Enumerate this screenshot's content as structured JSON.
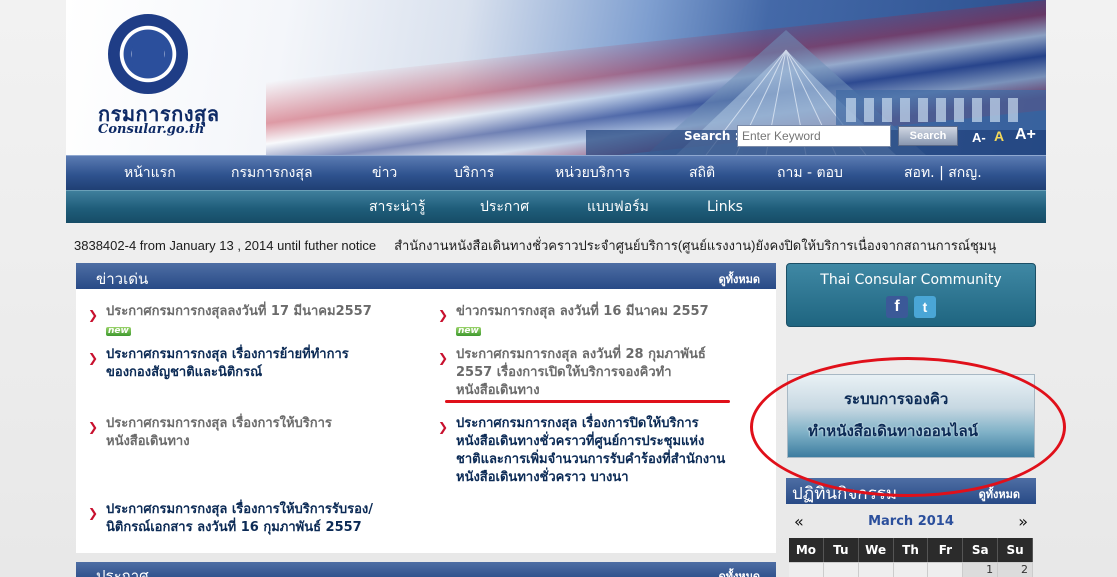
{
  "header": {
    "logo_th": "กรมการกงสุล",
    "logo_en": "Consular.go.th",
    "search_label": "Search :",
    "search_placeholder": "Enter Keyword",
    "search_button": "Search",
    "font_small": "A-",
    "font_mid": "A",
    "font_big": "A+"
  },
  "nav_primary": [
    {
      "label": "หน้าแรก"
    },
    {
      "label": "กรมการกงสุล"
    },
    {
      "label": "ข่าว"
    },
    {
      "label": "บริการ"
    },
    {
      "label": "หน่วยบริการ"
    },
    {
      "label": "สถิติ"
    },
    {
      "label": "ถาม - ตอบ"
    },
    {
      "label": "สอท. | สกญ."
    }
  ],
  "nav_secondary": [
    {
      "label": "สาระน่ารู้"
    },
    {
      "label": "ประกาศ"
    },
    {
      "label": "แบบฟอร์ม"
    },
    {
      "label": "Links"
    }
  ],
  "ticker": {
    "part1": "3838402-4  from January 13 , 2014 until futher notice",
    "part2": "สำนักงานหนังสือเดินทางชั่วคราวประจำศูนย์บริการ(ศูนย์แรงงาน)ยังคงปิดให้บริการเนื่องจากสถานการณ์ชุมนุ"
  },
  "news": {
    "title": "ข่าวเด่น",
    "see_all": "ดูทั้งหมด",
    "new_badge": "new",
    "items": [
      {
        "text": "ประกาศกรมการกงสุลลงวันที่ 17 มีนาคม2557"
      },
      {
        "text": "ข่าวกรมการกงสุล ลงวันที่ 16 มีนาคม 2557"
      },
      {
        "line1": "ประกาศกรมการกงสุล เรื่องการย้ายที่ทำการ",
        "line2": "ของกองสัญชาติและนิติกรณ์"
      },
      {
        "line1": "ประกาศกรมการกงสุล ลงวันที่ 28 กุมภาพันธ์",
        "line2": "2557 เรื่องการเปิดให้บริการจองคิวทำ",
        "line3": "หนังสือเดินทาง"
      },
      {
        "line1": "ประกาศกรมการกงสุล เรื่องการให้บริการ",
        "line2": "หนังสือเดินทาง"
      },
      {
        "line1": "ประกาศกรมการกงสุล เรื่องการปิดให้บริการ",
        "line2": "หนังสือเดินทางชั่วคราวที่ศูนย์การประชุมแห่ง",
        "line3": "ชาติและการเพิ่มจำนวนการรับคำร้องที่สำนักงาน",
        "line4": "หนังสือเดินทางชั่วคราว บางนา"
      },
      {
        "line1": "ประกาศกรมการกงสุล เรื่องการให้บริการรับรอง/",
        "line2": "นิติกรณ์เอกสาร ลงวันที่ 16 กุมภาพันธ์ 2557"
      }
    ]
  },
  "announce": {
    "title": "ประกาศ",
    "see_all": "ดูทั้งหมด"
  },
  "community": {
    "title": "Thai Consular Community",
    "facebook": "f",
    "twitter": "t"
  },
  "queue_banner": {
    "line1": "ระบบการจองคิว",
    "line2": "ทำหนังสือเดินทางออนไลน์"
  },
  "calendar": {
    "title": "ปฏิทินกิจกรรม",
    "see_all": "ดูทั้งหมด",
    "prev": "«",
    "next": "»",
    "month": "March 2014",
    "dow": [
      "Mo",
      "Tu",
      "We",
      "Th",
      "Fr",
      "Sa",
      "Su"
    ],
    "first_week": [
      "",
      "",
      "",
      "",
      "",
      "1",
      "2"
    ]
  },
  "colors": {
    "nav_primary": "#2f538f",
    "nav_secondary": "#1f5d7a",
    "arrow_red": "#c8102e",
    "annotation_red": "#e0101a"
  }
}
